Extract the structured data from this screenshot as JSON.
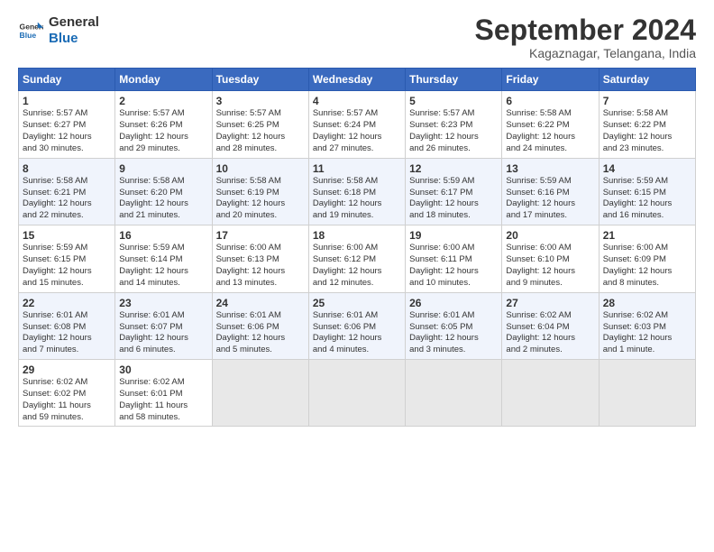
{
  "logo": {
    "line1": "General",
    "line2": "Blue"
  },
  "title": "September 2024",
  "subtitle": "Kagaznagar, Telangana, India",
  "headers": [
    "Sunday",
    "Monday",
    "Tuesday",
    "Wednesday",
    "Thursday",
    "Friday",
    "Saturday"
  ],
  "rows": [
    [
      {
        "day": "1",
        "lines": [
          "Sunrise: 5:57 AM",
          "Sunset: 6:27 PM",
          "Daylight: 12 hours",
          "and 30 minutes."
        ]
      },
      {
        "day": "2",
        "lines": [
          "Sunrise: 5:57 AM",
          "Sunset: 6:26 PM",
          "Daylight: 12 hours",
          "and 29 minutes."
        ]
      },
      {
        "day": "3",
        "lines": [
          "Sunrise: 5:57 AM",
          "Sunset: 6:25 PM",
          "Daylight: 12 hours",
          "and 28 minutes."
        ]
      },
      {
        "day": "4",
        "lines": [
          "Sunrise: 5:57 AM",
          "Sunset: 6:24 PM",
          "Daylight: 12 hours",
          "and 27 minutes."
        ]
      },
      {
        "day": "5",
        "lines": [
          "Sunrise: 5:57 AM",
          "Sunset: 6:23 PM",
          "Daylight: 12 hours",
          "and 26 minutes."
        ]
      },
      {
        "day": "6",
        "lines": [
          "Sunrise: 5:58 AM",
          "Sunset: 6:22 PM",
          "Daylight: 12 hours",
          "and 24 minutes."
        ]
      },
      {
        "day": "7",
        "lines": [
          "Sunrise: 5:58 AM",
          "Sunset: 6:22 PM",
          "Daylight: 12 hours",
          "and 23 minutes."
        ]
      }
    ],
    [
      {
        "day": "8",
        "lines": [
          "Sunrise: 5:58 AM",
          "Sunset: 6:21 PM",
          "Daylight: 12 hours",
          "and 22 minutes."
        ]
      },
      {
        "day": "9",
        "lines": [
          "Sunrise: 5:58 AM",
          "Sunset: 6:20 PM",
          "Daylight: 12 hours",
          "and 21 minutes."
        ]
      },
      {
        "day": "10",
        "lines": [
          "Sunrise: 5:58 AM",
          "Sunset: 6:19 PM",
          "Daylight: 12 hours",
          "and 20 minutes."
        ]
      },
      {
        "day": "11",
        "lines": [
          "Sunrise: 5:58 AM",
          "Sunset: 6:18 PM",
          "Daylight: 12 hours",
          "and 19 minutes."
        ]
      },
      {
        "day": "12",
        "lines": [
          "Sunrise: 5:59 AM",
          "Sunset: 6:17 PM",
          "Daylight: 12 hours",
          "and 18 minutes."
        ]
      },
      {
        "day": "13",
        "lines": [
          "Sunrise: 5:59 AM",
          "Sunset: 6:16 PM",
          "Daylight: 12 hours",
          "and 17 minutes."
        ]
      },
      {
        "day": "14",
        "lines": [
          "Sunrise: 5:59 AM",
          "Sunset: 6:15 PM",
          "Daylight: 12 hours",
          "and 16 minutes."
        ]
      }
    ],
    [
      {
        "day": "15",
        "lines": [
          "Sunrise: 5:59 AM",
          "Sunset: 6:15 PM",
          "Daylight: 12 hours",
          "and 15 minutes."
        ]
      },
      {
        "day": "16",
        "lines": [
          "Sunrise: 5:59 AM",
          "Sunset: 6:14 PM",
          "Daylight: 12 hours",
          "and 14 minutes."
        ]
      },
      {
        "day": "17",
        "lines": [
          "Sunrise: 6:00 AM",
          "Sunset: 6:13 PM",
          "Daylight: 12 hours",
          "and 13 minutes."
        ]
      },
      {
        "day": "18",
        "lines": [
          "Sunrise: 6:00 AM",
          "Sunset: 6:12 PM",
          "Daylight: 12 hours",
          "and 12 minutes."
        ]
      },
      {
        "day": "19",
        "lines": [
          "Sunrise: 6:00 AM",
          "Sunset: 6:11 PM",
          "Daylight: 12 hours",
          "and 10 minutes."
        ]
      },
      {
        "day": "20",
        "lines": [
          "Sunrise: 6:00 AM",
          "Sunset: 6:10 PM",
          "Daylight: 12 hours",
          "and 9 minutes."
        ]
      },
      {
        "day": "21",
        "lines": [
          "Sunrise: 6:00 AM",
          "Sunset: 6:09 PM",
          "Daylight: 12 hours",
          "and 8 minutes."
        ]
      }
    ],
    [
      {
        "day": "22",
        "lines": [
          "Sunrise: 6:01 AM",
          "Sunset: 6:08 PM",
          "Daylight: 12 hours",
          "and 7 minutes."
        ]
      },
      {
        "day": "23",
        "lines": [
          "Sunrise: 6:01 AM",
          "Sunset: 6:07 PM",
          "Daylight: 12 hours",
          "and 6 minutes."
        ]
      },
      {
        "day": "24",
        "lines": [
          "Sunrise: 6:01 AM",
          "Sunset: 6:06 PM",
          "Daylight: 12 hours",
          "and 5 minutes."
        ]
      },
      {
        "day": "25",
        "lines": [
          "Sunrise: 6:01 AM",
          "Sunset: 6:06 PM",
          "Daylight: 12 hours",
          "and 4 minutes."
        ]
      },
      {
        "day": "26",
        "lines": [
          "Sunrise: 6:01 AM",
          "Sunset: 6:05 PM",
          "Daylight: 12 hours",
          "and 3 minutes."
        ]
      },
      {
        "day": "27",
        "lines": [
          "Sunrise: 6:02 AM",
          "Sunset: 6:04 PM",
          "Daylight: 12 hours",
          "and 2 minutes."
        ]
      },
      {
        "day": "28",
        "lines": [
          "Sunrise: 6:02 AM",
          "Sunset: 6:03 PM",
          "Daylight: 12 hours",
          "and 1 minute."
        ]
      }
    ],
    [
      {
        "day": "29",
        "lines": [
          "Sunrise: 6:02 AM",
          "Sunset: 6:02 PM",
          "Daylight: 11 hours",
          "and 59 minutes."
        ]
      },
      {
        "day": "30",
        "lines": [
          "Sunrise: 6:02 AM",
          "Sunset: 6:01 PM",
          "Daylight: 11 hours",
          "and 58 minutes."
        ]
      },
      {
        "day": "",
        "lines": []
      },
      {
        "day": "",
        "lines": []
      },
      {
        "day": "",
        "lines": []
      },
      {
        "day": "",
        "lines": []
      },
      {
        "day": "",
        "lines": []
      }
    ]
  ]
}
